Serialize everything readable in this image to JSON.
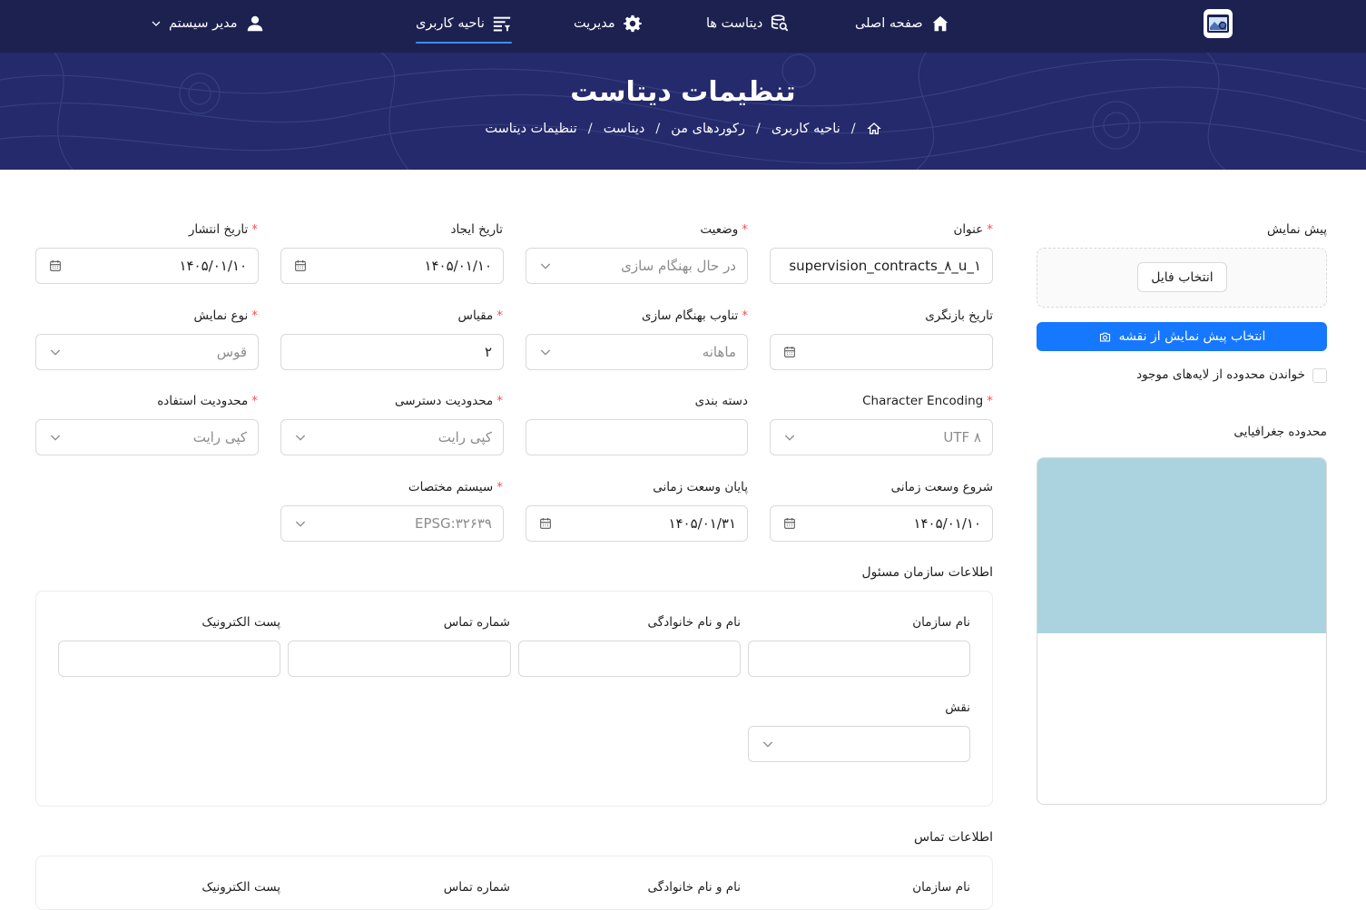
{
  "nav": {
    "home": "صفحه اصلی",
    "datasets": "دیتاست ها",
    "admin": "مدیریت",
    "user_area": "ناحیه کاربری",
    "user_menu": "مدیر سیستم"
  },
  "hero": {
    "title": "تنظیمات دیتاست",
    "breadcrumbs": [
      "ناحیه کاربری",
      "رکوردهای من",
      "دیتاست",
      "تنظیمات دیتاست"
    ]
  },
  "preview": {
    "label": "پیش نمایش",
    "choose_file": "انتخاب فایل",
    "map_button": "انتخاب پیش نمایش از نقشه",
    "read_extent_label": "خواندن محدوده از لایه‌های موجود",
    "geo_extent_label": "محدوده جغرافیایی"
  },
  "form": {
    "title": {
      "label": "عنوان",
      "value": "supervision_contracts_۸_u_۱"
    },
    "status": {
      "label": "وضعیت",
      "value": "در حال بهنگام سازی"
    },
    "created": {
      "label": "تاریخ ایجاد",
      "value": "۱۴۰۵/۰۱/۱۰"
    },
    "published": {
      "label": "تاریخ انتشار",
      "value": "۱۴۰۵/۰۱/۱۰"
    },
    "revision": {
      "label": "تاریخ بازنگری",
      "value": ""
    },
    "frequency": {
      "label": "تناوب بهنگام سازی",
      "value": "ماهانه"
    },
    "scale": {
      "label": "مقیاس",
      "value": "۲"
    },
    "display_type": {
      "label": "نوع نمایش",
      "value": "قوس"
    },
    "encoding": {
      "label": "Character Encoding",
      "value": "UTF ۸"
    },
    "category": {
      "label": "دسته بندی",
      "value": ""
    },
    "access": {
      "label": "محدودیت دسترسی",
      "value": "کپی رایت"
    },
    "usage": {
      "label": "محدودیت استفاده",
      "value": "کپی رایت"
    },
    "time_start": {
      "label": "شروع وسعت زمانی",
      "value": "۱۴۰۵/۰۱/۱۰"
    },
    "time_end": {
      "label": "پایان وسعت زمانی",
      "value": "۱۴۰۵/۰۱/۳۱"
    },
    "crs": {
      "label": "سیستم مختصات",
      "value": "EPSG:۳۲۶۳۹"
    }
  },
  "org_section": {
    "title": "اطلاعات سازمان مسئول",
    "org_name": "نام سازمان",
    "full_name": "نام و نام خانوادگی",
    "phone": "شماره تماس",
    "email": "پست الکترونیک",
    "role": "نقش"
  },
  "contact_section": {
    "title": "اطلاعات تماس",
    "org_name": "نام سازمان",
    "full_name": "نام و نام خانوادگی",
    "phone": "شماره تماس",
    "email": "پست الکترونیک"
  },
  "colors": {
    "nav_bg": "#1d2150",
    "hero_bg": "#242a6b",
    "primary": "#1677ff",
    "required": "#ff4d4f",
    "map_water": "#aad3df"
  }
}
